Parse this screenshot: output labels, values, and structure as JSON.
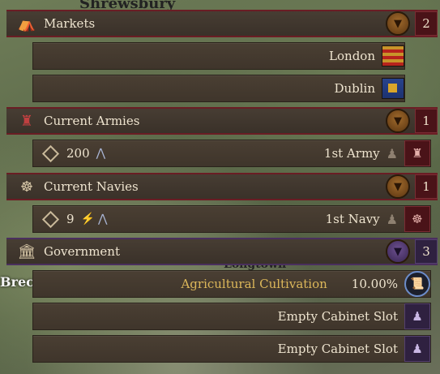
{
  "map": {
    "labels": [
      "Shrewsbury",
      "Brecknock",
      "Longtown"
    ]
  },
  "markets": {
    "title": "Markets",
    "count": "2",
    "icon": "market-stall-icon",
    "items": [
      {
        "name": "London",
        "flag": "london-coat-of-arms-icon"
      },
      {
        "name": "Dublin",
        "flag": "dublin-coat-of-arms-icon"
      }
    ]
  },
  "armies": {
    "title": "Current Armies",
    "count": "1",
    "icon": "soldiers-icon",
    "items": [
      {
        "size": "200",
        "name": "1st Army"
      }
    ]
  },
  "navies": {
    "title": "Current Navies",
    "count": "1",
    "icon": "ship-wheel-icon",
    "items": [
      {
        "size": "9",
        "name": "1st Navy"
      }
    ]
  },
  "government": {
    "title": "Government",
    "count": "3",
    "icon": "parliament-building-icon",
    "items": [
      {
        "name": "Agricultural Cultivation",
        "value": "10.00%"
      },
      {
        "name": "Empty Cabinet Slot"
      },
      {
        "name": "Empty Cabinet Slot"
      }
    ]
  },
  "colors": {
    "header_red": "#6a1d24",
    "header_purple": "#4a2f5e",
    "gold_text": "#dcb75a",
    "panel": "#3f352b"
  }
}
